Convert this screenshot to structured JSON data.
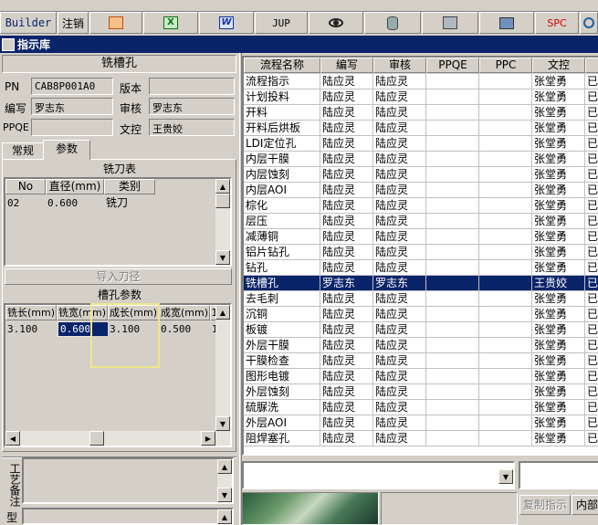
{
  "toolbar": {
    "builder": "Builder",
    "logout": "注销",
    "jup": "JUP",
    "spc": "SPC"
  },
  "window": {
    "title": "指示库"
  },
  "left": {
    "header": "铣槽孔",
    "pn_label": "PN",
    "pn_value": "CAB8P001A0",
    "version_label": "版本",
    "version_value": "",
    "author_label": "编写",
    "author_value": "罗志东",
    "review_label": "审核",
    "review_value": "罗志东",
    "ppqe_label": "PPQE",
    "ppqe_value": "",
    "doc_label": "文控",
    "doc_value": "王贵姣",
    "tabs": [
      "常规",
      "参数"
    ],
    "tool_table_title": "铣刀表",
    "tool_cols": [
      "No",
      "直径(mm)",
      "类别"
    ],
    "tool_rows": [
      [
        "02",
        "0.600",
        "铣刀"
      ]
    ],
    "import_button": "导入刀径",
    "slot_title": "槽孔参数",
    "slot_cols": [
      "铣长(mm)",
      "铣宽(mm)",
      "成长(mm)",
      "成宽(mm)",
      "1"
    ],
    "slot_rows": [
      [
        "3.100",
        "0.600",
        "3.100",
        "0.500",
        "1"
      ]
    ],
    "notes_label": "工艺备注",
    "type_label": "型"
  },
  "right": {
    "cols": [
      "流程名称",
      "编写",
      "审核",
      "PPQE",
      "PPC",
      "文控",
      ""
    ],
    "rows": [
      [
        "流程指示",
        "陆应灵",
        "陆应灵",
        "",
        "",
        "张堂勇",
        "已"
      ],
      [
        "计划投料",
        "陆应灵",
        "陆应灵",
        "",
        "",
        "张堂勇",
        "已"
      ],
      [
        "开料",
        "陆应灵",
        "陆应灵",
        "",
        "",
        "张堂勇",
        "已"
      ],
      [
        "开料后烘板",
        "陆应灵",
        "陆应灵",
        "",
        "",
        "张堂勇",
        "已"
      ],
      [
        "LDI定位孔",
        "陆应灵",
        "陆应灵",
        "",
        "",
        "张堂勇",
        "已"
      ],
      [
        "内层干膜",
        "陆应灵",
        "陆应灵",
        "",
        "",
        "张堂勇",
        "已"
      ],
      [
        "内层蚀刻",
        "陆应灵",
        "陆应灵",
        "",
        "",
        "张堂勇",
        "已"
      ],
      [
        "内层AOI",
        "陆应灵",
        "陆应灵",
        "",
        "",
        "张堂勇",
        "已"
      ],
      [
        "棕化",
        "陆应灵",
        "陆应灵",
        "",
        "",
        "张堂勇",
        "已"
      ],
      [
        "层压",
        "陆应灵",
        "陆应灵",
        "",
        "",
        "张堂勇",
        "已"
      ],
      [
        "减薄铜",
        "陆应灵",
        "陆应灵",
        "",
        "",
        "张堂勇",
        "已"
      ],
      [
        "铝片钻孔",
        "陆应灵",
        "陆应灵",
        "",
        "",
        "张堂勇",
        "已"
      ],
      [
        "钻孔",
        "陆应灵",
        "陆应灵",
        "",
        "",
        "张堂勇",
        "已"
      ],
      [
        "铣槽孔",
        "罗志东",
        "罗志东",
        "",
        "",
        "王贵姣",
        "已"
      ],
      [
        "去毛刺",
        "陆应灵",
        "陆应灵",
        "",
        "",
        "张堂勇",
        "已"
      ],
      [
        "沉铜",
        "陆应灵",
        "陆应灵",
        "",
        "",
        "张堂勇",
        "已"
      ],
      [
        "板镀",
        "陆应灵",
        "陆应灵",
        "",
        "",
        "张堂勇",
        "已"
      ],
      [
        "外层干膜",
        "陆应灵",
        "陆应灵",
        "",
        "",
        "张堂勇",
        "已"
      ],
      [
        "干膜检查",
        "陆应灵",
        "陆应灵",
        "",
        "",
        "张堂勇",
        "已"
      ],
      [
        "图形电镀",
        "陆应灵",
        "陆应灵",
        "",
        "",
        "张堂勇",
        "已"
      ],
      [
        "外层蚀刻",
        "陆应灵",
        "陆应灵",
        "",
        "",
        "张堂勇",
        "已"
      ],
      [
        "硫脲洗",
        "陆应灵",
        "陆应灵",
        "",
        "",
        "张堂勇",
        "已"
      ],
      [
        "外层AOI",
        "陆应灵",
        "陆应灵",
        "",
        "",
        "张堂勇",
        "已"
      ],
      [
        "阻焊塞孔",
        "陆应灵",
        "陆应灵",
        "",
        "",
        "张堂勇",
        "已"
      ]
    ],
    "selected_row": 13,
    "copy_button": "复制指示",
    "internal_button": "内部"
  },
  "colors": {
    "titlebar": "#0a246a",
    "selected": "#0a246a",
    "highlight_box": "#f0e68c"
  }
}
